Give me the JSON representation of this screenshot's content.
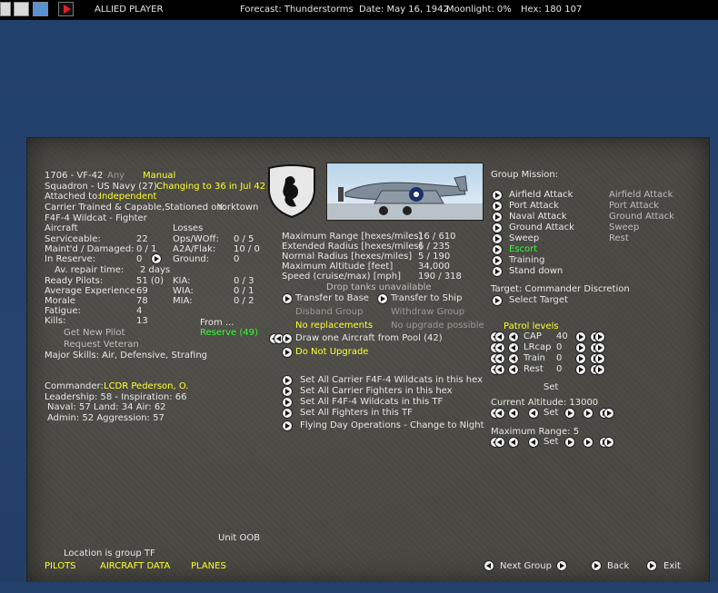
{
  "topbar": {
    "player": "ALLIED PLAYER",
    "forecast": "Forecast: Thunderstorms",
    "date": "Date: May 16, 1942",
    "moonlight": "Moonlight: 0%",
    "hex": "Hex: 180 107",
    "icons": [
      "oob-icon",
      "report-icon",
      "window-icon",
      "play-icon"
    ]
  },
  "group": {
    "id": "1706 - VF-42",
    "any": "Any",
    "manual": "Manual",
    "squadron": "Squadron - US Navy (27)",
    "changing": "Changing to 36 in Jul 42",
    "attached_label": "Attached to:",
    "attached_value": "Independent",
    "trained": "Carrier Trained & Capable,Stationed on:",
    "station": "Yorktown",
    "aircraft_type": "F4F-4 Wildcat - Fighter"
  },
  "aircraft": {
    "header": "Aircraft",
    "serviceable_label": "Serviceable:",
    "serviceable": "22",
    "maint_label": "Maint'd / Damaged:",
    "maint": "0 / 1",
    "reserve_label": "In Reserve:",
    "reserve": "0",
    "repair_label": "Av. repair time:",
    "repair": "2 days"
  },
  "losses": {
    "header": "Losses",
    "ops_label": "Ops/WOff:",
    "ops": "0 / 5",
    "a2a_label": "A2A/Flak:",
    "a2a": "10 / 0",
    "ground_label": "Ground:",
    "ground": "0"
  },
  "pilots": {
    "ready_label": "Ready Pilots:",
    "ready": "51 (0)",
    "exp_label": "Average Experience",
    "exp": "69",
    "morale_label": "Morale",
    "morale": "78",
    "fatigue_label": "Fatigue:",
    "fatigue": "4",
    "kills_label": "Kills:",
    "kills": "13",
    "kia_label": "KIA:",
    "kia": "0 / 3",
    "wia_label": "WIA:",
    "wia": "0 / 1",
    "mia_label": "MIA:",
    "mia": "0 / 2",
    "get_new": "Get New Pilot",
    "request_vet": "Request Veteran",
    "from": "From ...",
    "reserve_pool": "Reserve (49)",
    "skills": "Major Skills: Air, Defensive, Strafing"
  },
  "commander": {
    "label": "Commander:",
    "name": "LCDR Pederson, O.",
    "leadership": "Leadership: 58 - Inspiration: 66",
    "naval": "Naval:  57  Land:  34  Air:  62",
    "admin": "Admin:  52  Aggression:  57"
  },
  "specs": {
    "max_range_label": "Maximum Range [hexes/miles]",
    "max_range": "16 / 610",
    "ext_label": "Extended Radius [hexes/miles]",
    "ext": "6 / 235",
    "norm_label": "Normal Radius [hexes/miles]",
    "norm": "5 / 190",
    "alt_label": "Maximum Altitude [feet]",
    "alt": "34,000",
    "speed_label": "Speed (cruise/max) [mph]",
    "speed": "190 / 318",
    "drop_tanks": "Drop tanks unavailable"
  },
  "actions": {
    "transfer_base": "Transfer to Base",
    "transfer_ship": "Transfer to Ship",
    "disband": "Disband Group",
    "withdraw": "Withdraw Group",
    "no_replacements": "No replacements",
    "no_upgrade": "No upgrade possible",
    "draw_one": "Draw one Aircraft from Pool (42)",
    "do_not_upgrade": "Do Not Upgrade",
    "set1": "Set All Carrier F4F-4 Wildcats in this hex",
    "set2": "Set All Carrier Fighters in this hex",
    "set3": "Set All F4F-4 Wildcats in this TF",
    "set4": "Set All Fighters in this TF",
    "flying_day": "Flying Day Operations - Change to Night"
  },
  "mission": {
    "header": "Group Mission:",
    "items": [
      "Airfield Attack",
      "Port Attack",
      "Naval Attack",
      "Ground Attack",
      "Sweep",
      "Escort",
      "Training",
      "Stand down"
    ],
    "secondary": [
      "Airfield Attack",
      "Port Attack",
      "Ground Attack",
      "Sweep",
      "Rest"
    ],
    "target": "Target: Commander Discretion",
    "select_target": "Select Target"
  },
  "patrol": {
    "header": "Patrol levels",
    "rows": [
      {
        "label": "CAP",
        "value": "40",
        "set": "Set"
      },
      {
        "label": "LRcap",
        "value": "0"
      },
      {
        "label": "Train",
        "value": "0"
      },
      {
        "label": "Rest",
        "value": "0"
      }
    ]
  },
  "altitude": {
    "label": "Current Altitude: 13000",
    "set": "Set"
  },
  "maxrange": {
    "label": "Maximum Range: 5",
    "set": "Set"
  },
  "footer": {
    "unit_oob": "Unit OOB",
    "location": "Location is group TF",
    "pilots": "PILOTS",
    "aircraft_data": "AIRCRAFT DATA",
    "planes": "PLANES",
    "next_group": "Next Group",
    "back": "Back",
    "exit": "Exit"
  },
  "colors": {
    "highlight": "#ffff33",
    "escort": "#33ff33",
    "panel": "#4b4a44"
  }
}
